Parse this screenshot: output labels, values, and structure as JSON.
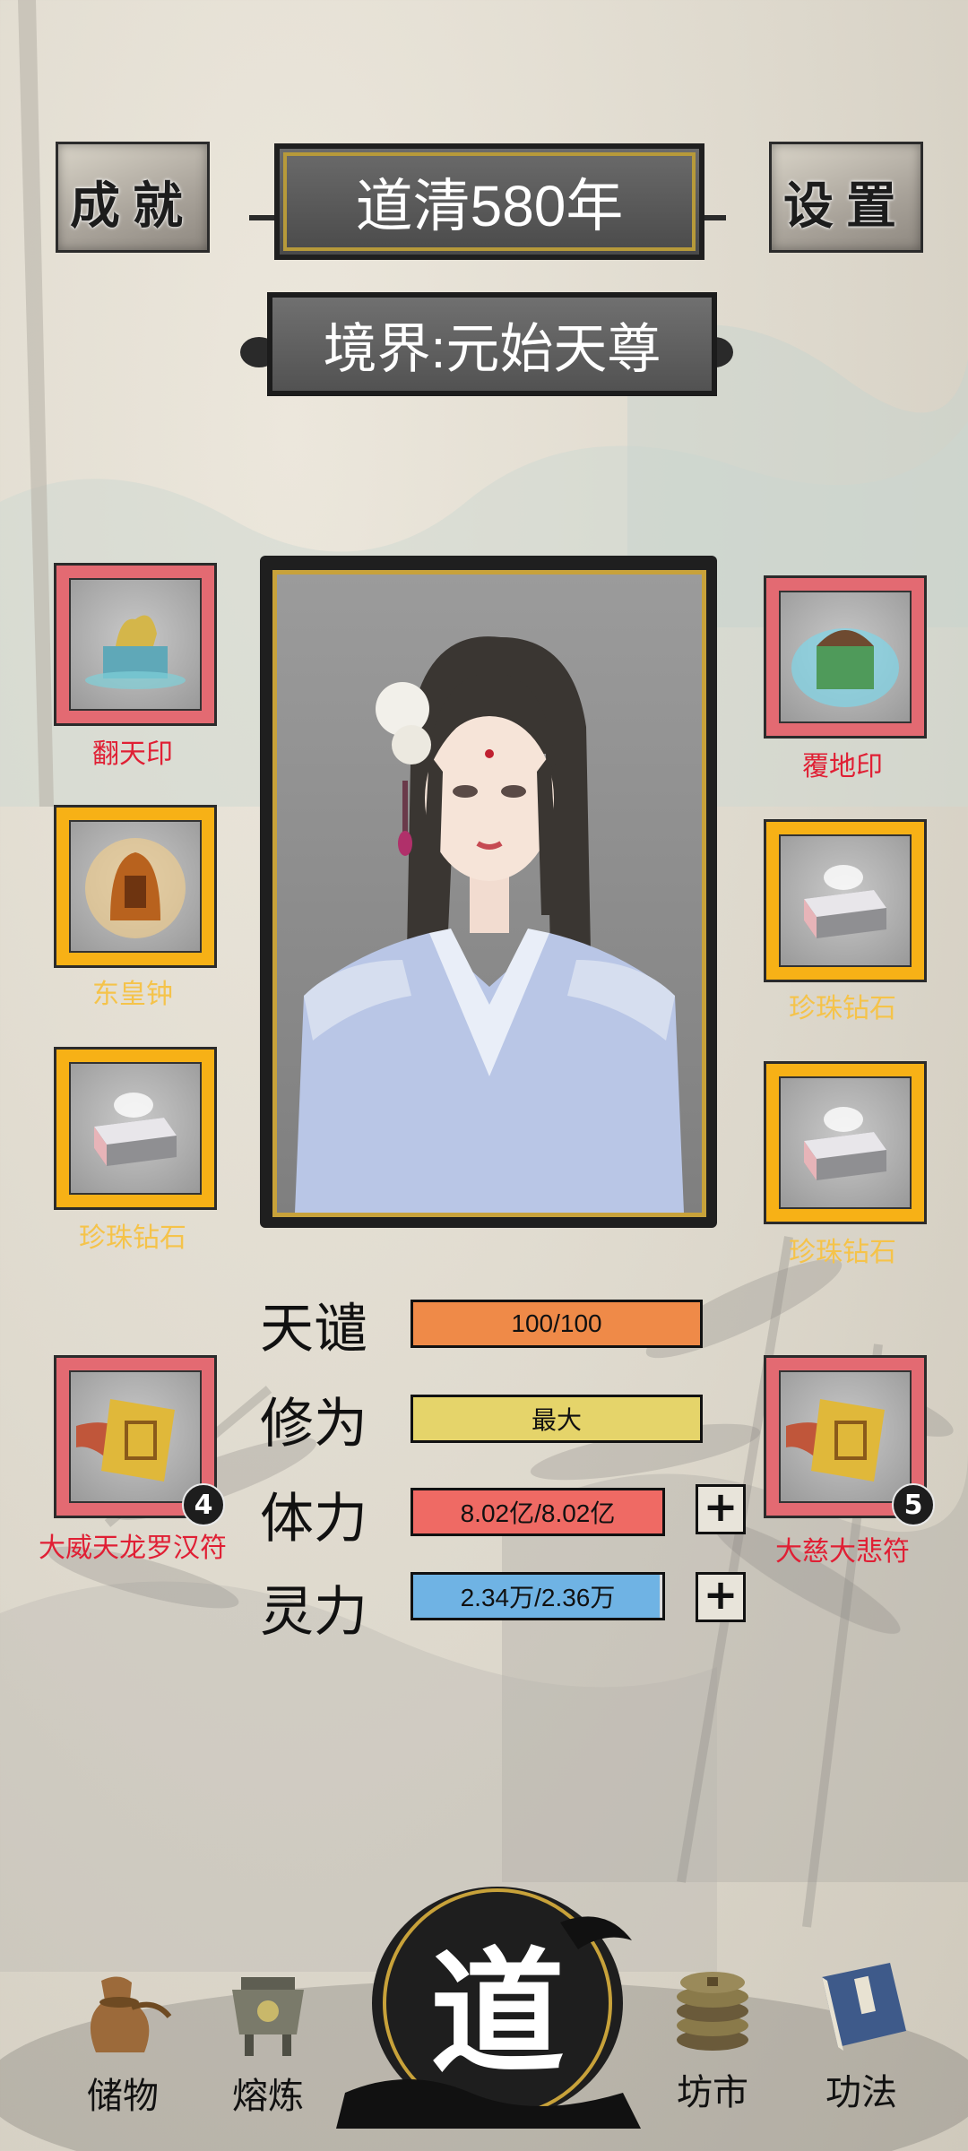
{
  "header": {
    "achievement_label": "成就",
    "settings_label": "设置",
    "era_title": "道清580年",
    "realm_text": "境界:元始天尊"
  },
  "equipment": {
    "left": [
      {
        "name": "翻天印",
        "frame": "red"
      },
      {
        "name": "东皇钟",
        "frame": "gold"
      },
      {
        "name": "珍珠钻石",
        "frame": "gold"
      }
    ],
    "right": [
      {
        "name": "覆地印",
        "frame": "red"
      },
      {
        "name": "珍珠钻石",
        "frame": "gold"
      },
      {
        "name": "珍珠钻石",
        "frame": "gold"
      }
    ]
  },
  "talismans": {
    "left": {
      "name": "大威天龙罗汉符",
      "count": "4"
    },
    "right": {
      "name": "大慈大悲符",
      "count": "5"
    }
  },
  "stats": [
    {
      "name": "天谴",
      "value": "100/100",
      "fill": 1.0,
      "color": "#ef8a48",
      "has_plus": false
    },
    {
      "name": "修为",
      "value": "最大",
      "fill": 1.0,
      "color": "#e5d46a",
      "has_plus": false
    },
    {
      "name": "体力",
      "value": "8.02亿/8.02亿",
      "fill": 1.0,
      "color": "#ef6a64",
      "has_plus": true
    },
    {
      "name": "灵力",
      "value": "2.34万/2.36万",
      "fill": 0.99,
      "color": "#6fb3e4",
      "has_plus": true
    }
  ],
  "plus_symbol": "+",
  "nav": {
    "storage": "储物",
    "smelting": "熔炼",
    "dao": "道",
    "market": "坊市",
    "skills": "功法"
  }
}
